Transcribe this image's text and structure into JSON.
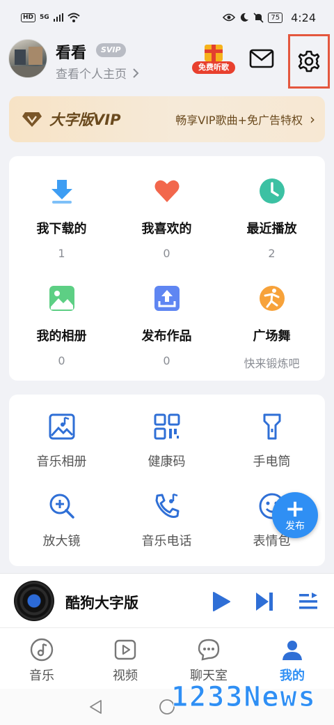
{
  "status_bar": {
    "hd": "HD",
    "network": "5G",
    "battery": "75",
    "time": "4:24"
  },
  "profile": {
    "name": "看看",
    "badge": "SVIP",
    "link": "查看个人主页",
    "gift_label": "免费听歌"
  },
  "vip": {
    "title": "大字版VIP",
    "desc": "畅享VIP歌曲+免广告特权"
  },
  "library": [
    {
      "title": "我下载的",
      "count": "1",
      "icon": "download-icon"
    },
    {
      "title": "我喜欢的",
      "count": "0",
      "icon": "heart-icon"
    },
    {
      "title": "最近播放",
      "count": "2",
      "icon": "clock-icon"
    },
    {
      "title": "我的相册",
      "count": "0",
      "icon": "album-icon"
    },
    {
      "title": "发布作品",
      "count": "0",
      "icon": "upload-icon"
    },
    {
      "title": "广场舞",
      "count": "快来锻炼吧",
      "icon": "dance-icon"
    }
  ],
  "tools": [
    {
      "title": "音乐相册",
      "icon": "music-album-icon"
    },
    {
      "title": "健康码",
      "icon": "qr-code-icon"
    },
    {
      "title": "手电筒",
      "icon": "flashlight-icon"
    },
    {
      "title": "放大镜",
      "icon": "magnifier-icon"
    },
    {
      "title": "音乐电话",
      "icon": "music-phone-icon"
    },
    {
      "title": "表情包",
      "icon": "emoji-icon"
    }
  ],
  "fab": {
    "label": "发布"
  },
  "player": {
    "title": "酷狗大字版"
  },
  "nav": [
    {
      "label": "音乐",
      "icon": "music-note-icon"
    },
    {
      "label": "视频",
      "icon": "video-icon"
    },
    {
      "label": "聊天室",
      "icon": "chat-icon"
    },
    {
      "label": "我的",
      "icon": "profile-icon"
    }
  ],
  "watermark": "1233News",
  "colors": {
    "accent": "#2f8ff4",
    "highlight_border": "#e4573e",
    "vip_text": "#6a4a1e",
    "page_bg": "#f1f2f6"
  }
}
